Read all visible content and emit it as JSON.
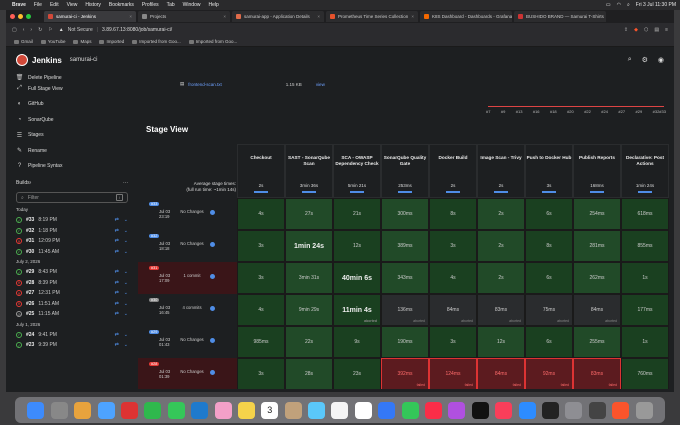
{
  "menubar": {
    "items": [
      "Brave",
      "File",
      "Edit",
      "View",
      "History",
      "Bookmarks",
      "Profiles",
      "Tab",
      "Window",
      "Help"
    ],
    "clock": "Fri 3 Jul 11:30 PM"
  },
  "tabs": [
    {
      "label": "samurai-ci - Jenkins",
      "color": "#d24939",
      "active": true
    },
    {
      "label": "Projects",
      "color": "#888888",
      "active": false
    },
    {
      "label": "samurai-app - Application Details",
      "color": "#e06b4a",
      "active": false
    },
    {
      "label": "Prometheus Time Series Collection",
      "color": "#e6522c",
      "active": false
    },
    {
      "label": "K8S Dashboard - Dashboards - Grafana",
      "color": "#f46800",
      "active": false
    },
    {
      "label": "BUSHIDO BRAND — Samurai T-Shirts",
      "color": "#cc3333",
      "active": false
    }
  ],
  "url": {
    "security": "Not Secure",
    "address": "3.89.67.13:8080/job/samurai-ci/"
  },
  "bookmarks": [
    "Gmail",
    "YouTube",
    "Maps",
    "Imported",
    "Imported from Goo...",
    "Imported from Goo..."
  ],
  "header": {
    "brand": "Jenkins",
    "crumb": "samurai-ci"
  },
  "sidebar": {
    "items": [
      {
        "label": "Delete Pipeline",
        "icon": "trash-icon"
      },
      {
        "label": "Full Stage View",
        "icon": "fullscreen-icon"
      },
      {
        "label": "GitHub",
        "icon": "github-icon"
      },
      {
        "label": "SonarQube",
        "icon": "sonarqube-icon"
      },
      {
        "label": "Stages",
        "icon": "stages-icon"
      },
      {
        "label": "Rename",
        "icon": "rename-icon"
      },
      {
        "label": "Pipeline Syntax",
        "icon": "help-icon"
      }
    ],
    "builds_label": "Builds",
    "filter_placeholder": "Filter",
    "filter_shortcut": "/",
    "groups": [
      {
        "day": "Today",
        "builds": [
          {
            "num": "#33",
            "time": "8:19 PM",
            "status": "ok"
          },
          {
            "num": "#32",
            "time": "1:18 PM",
            "status": "ok"
          },
          {
            "num": "#31",
            "time": "12:09 PM",
            "status": "fail"
          },
          {
            "num": "#30",
            "time": "11:45 AM",
            "status": "ok"
          }
        ]
      },
      {
        "day": "July 2, 2026",
        "builds": [
          {
            "num": "#29",
            "time": "8:43 PM",
            "status": "ok"
          },
          {
            "num": "#28",
            "time": "8:39 PM",
            "status": "fail"
          },
          {
            "num": "#27",
            "time": "12:31 PM",
            "status": "fail"
          },
          {
            "num": "#26",
            "time": "11:51 AM",
            "status": "fail"
          },
          {
            "num": "#25",
            "time": "11:15 AM",
            "status": "ab"
          }
        ]
      },
      {
        "day": "July 1, 2026",
        "builds": [
          {
            "num": "#24",
            "time": "9:41 PM",
            "status": "ok"
          },
          {
            "num": "#23",
            "time": "9:39 PM",
            "status": "ok"
          }
        ]
      }
    ]
  },
  "artifact": {
    "name": "frontend-scan.txt",
    "size": "1.15 KB",
    "view": "view"
  },
  "trend_labels": [
    "#7",
    "#9",
    "#13",
    "#16",
    "#18",
    "#20",
    "#22",
    "#24",
    "#27",
    "#29",
    "#32#33"
  ],
  "stage_view": {
    "title": "Stage View",
    "avg_label": "Average stage times:",
    "avg_full": "(full run time: ~1min 14s)",
    "stages": [
      {
        "name": "Checkout",
        "avg": "2s"
      },
      {
        "name": "SAST - SonarQube Scan",
        "avg": "3min 36s"
      },
      {
        "name": "SCA - OWASP Dependency Check",
        "avg": "5min 21s"
      },
      {
        "name": "SonarQube Quality Gate",
        "avg": "253ms"
      },
      {
        "name": "Docker Build",
        "avg": "2s"
      },
      {
        "name": "Image Scan - Trivy",
        "avg": "2s"
      },
      {
        "name": "Push to Docker Hub",
        "avg": "3s"
      },
      {
        "name": "Publish Reports",
        "avg": "168ms"
      },
      {
        "name": "Declarative: Post Actions",
        "avg": "1min 24s"
      }
    ],
    "rows": [
      {
        "badge": "#33",
        "date": "Jul 03",
        "time": "23:19",
        "changes": "No Changes",
        "status": "ok",
        "cells": [
          {
            "v": "4s",
            "s": "ok"
          },
          {
            "v": "27s",
            "s": "ok"
          },
          {
            "v": "21s",
            "s": "ok"
          },
          {
            "v": "300ms",
            "s": "ok"
          },
          {
            "v": "8s",
            "s": "ok"
          },
          {
            "v": "2s",
            "s": "ok"
          },
          {
            "v": "6s",
            "s": "ok"
          },
          {
            "v": "254ms",
            "s": "ok"
          },
          {
            "v": "618ms",
            "s": "ok"
          }
        ]
      },
      {
        "badge": "#32",
        "date": "Jul 03",
        "time": "18:18",
        "changes": "No Changes",
        "status": "ok",
        "cells": [
          {
            "v": "3s",
            "s": "ok"
          },
          {
            "v": "1min 24s",
            "s": "ok",
            "big": true
          },
          {
            "v": "12s",
            "s": "ok"
          },
          {
            "v": "389ms",
            "s": "ok"
          },
          {
            "v": "3s",
            "s": "ok"
          },
          {
            "v": "2s",
            "s": "ok"
          },
          {
            "v": "8s",
            "s": "ok"
          },
          {
            "v": "281ms",
            "s": "ok"
          },
          {
            "v": "855ms",
            "s": "ok"
          }
        ]
      },
      {
        "badge": "#31",
        "date": "Jul 03",
        "time": "17:09",
        "changes": "1 commit",
        "status": "fail",
        "cells": [
          {
            "v": "3s",
            "s": "ok"
          },
          {
            "v": "3min 31s",
            "s": "ok"
          },
          {
            "v": "40min 6s",
            "s": "ok",
            "big": true
          },
          {
            "v": "343ms",
            "s": "ok"
          },
          {
            "v": "4s",
            "s": "ok"
          },
          {
            "v": "2s",
            "s": "ok"
          },
          {
            "v": "6s",
            "s": "ok"
          },
          {
            "v": "262ms",
            "s": "ok"
          },
          {
            "v": "1s",
            "s": "ok"
          }
        ]
      },
      {
        "badge": "#30",
        "date": "Jul 03",
        "time": "16:45",
        "changes": "4 commits",
        "status": "ab",
        "cells": [
          {
            "v": "4s",
            "s": "ok"
          },
          {
            "v": "9min 29s",
            "s": "ok"
          },
          {
            "v": "11min 4s",
            "s": "ok",
            "big": true,
            "tag": "aborted"
          },
          {
            "v": "136ms",
            "s": "ab",
            "tag": "aborted"
          },
          {
            "v": "84ms",
            "s": "ab",
            "tag": "aborted"
          },
          {
            "v": "83ms",
            "s": "ab",
            "tag": "aborted"
          },
          {
            "v": "75ms",
            "s": "ab",
            "tag": "aborted"
          },
          {
            "v": "84ms",
            "s": "ab",
            "tag": "aborted"
          },
          {
            "v": "177ms",
            "s": "ok"
          }
        ]
      },
      {
        "badge": "#29",
        "date": "Jul 03",
        "time": "01:43",
        "changes": "No Changes",
        "status": "ok",
        "cells": [
          {
            "v": "985ms",
            "s": "ok"
          },
          {
            "v": "22s",
            "s": "ok"
          },
          {
            "v": "9s",
            "s": "ok"
          },
          {
            "v": "190ms",
            "s": "ok"
          },
          {
            "v": "3s",
            "s": "ok"
          },
          {
            "v": "12s",
            "s": "ok"
          },
          {
            "v": "6s",
            "s": "ok"
          },
          {
            "v": "255ms",
            "s": "ok"
          },
          {
            "v": "1s",
            "s": "ok"
          }
        ]
      },
      {
        "badge": "#28",
        "date": "Jul 03",
        "time": "01:39",
        "changes": "No Changes",
        "status": "fail",
        "cells": [
          {
            "v": "3s",
            "s": "ok"
          },
          {
            "v": "28s",
            "s": "ok"
          },
          {
            "v": "23s",
            "s": "ok"
          },
          {
            "v": "392ms",
            "s": "fail",
            "tag": "failed"
          },
          {
            "v": "124ms",
            "s": "fail",
            "tag": "failed"
          },
          {
            "v": "84ms",
            "s": "fail",
            "tag": "failed"
          },
          {
            "v": "92ms",
            "s": "fail",
            "tag": "failed"
          },
          {
            "v": "83ms",
            "s": "fail",
            "tag": "failed"
          },
          {
            "v": "760ms",
            "s": "ok"
          }
        ]
      }
    ]
  },
  "colors": {
    "ok": "#1a4020",
    "fail": "#5c1b1f",
    "accent": "#4f8de6",
    "jenkins_red": "#d24939"
  },
  "dock_apps": [
    "finder-icon",
    "launchpad-icon",
    "chrome-icon",
    "mail-icon",
    "pdf-icon",
    "facetime-icon",
    "messages-icon",
    "vscode-icon",
    "photos-icon",
    "notes-icon",
    "calendar-icon",
    "contacts-icon",
    "preview-icon",
    "reminders-icon",
    "freeform-icon",
    "keynote-icon",
    "numbers-icon",
    "music-icon",
    "podcasts-icon",
    "tv-icon",
    "news-icon",
    "appstore-icon",
    "terminal-icon",
    "settings-icon",
    "sites-icon",
    "brave-icon",
    "trash-icon"
  ],
  "calendar_day": "3"
}
